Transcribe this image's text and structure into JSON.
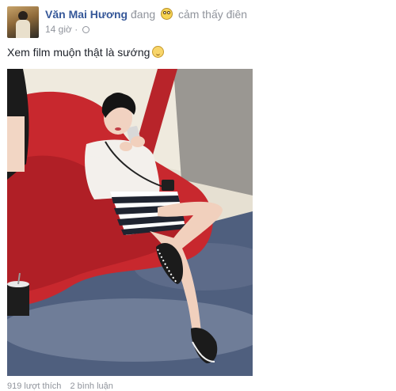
{
  "post": {
    "author": "Văn Mai Hương",
    "feeling_prefix": "đang",
    "feeling_text": "cảm thấy điên",
    "feeling_icon": "crazy-face-emoji-icon",
    "timestamp": "14 giờ",
    "separator": "·",
    "privacy_icon": "globe-icon",
    "caption": "Xem film muộn thật là sướng",
    "caption_icon": "blush-emoji-icon",
    "photo_description_icon": "photo-image",
    "likes": "919 lượt thích",
    "comments": "2 bình luận"
  },
  "colors": {
    "author_link": "#365899",
    "meta_gray": "#90949c",
    "sofa_red": "#c8282e"
  }
}
